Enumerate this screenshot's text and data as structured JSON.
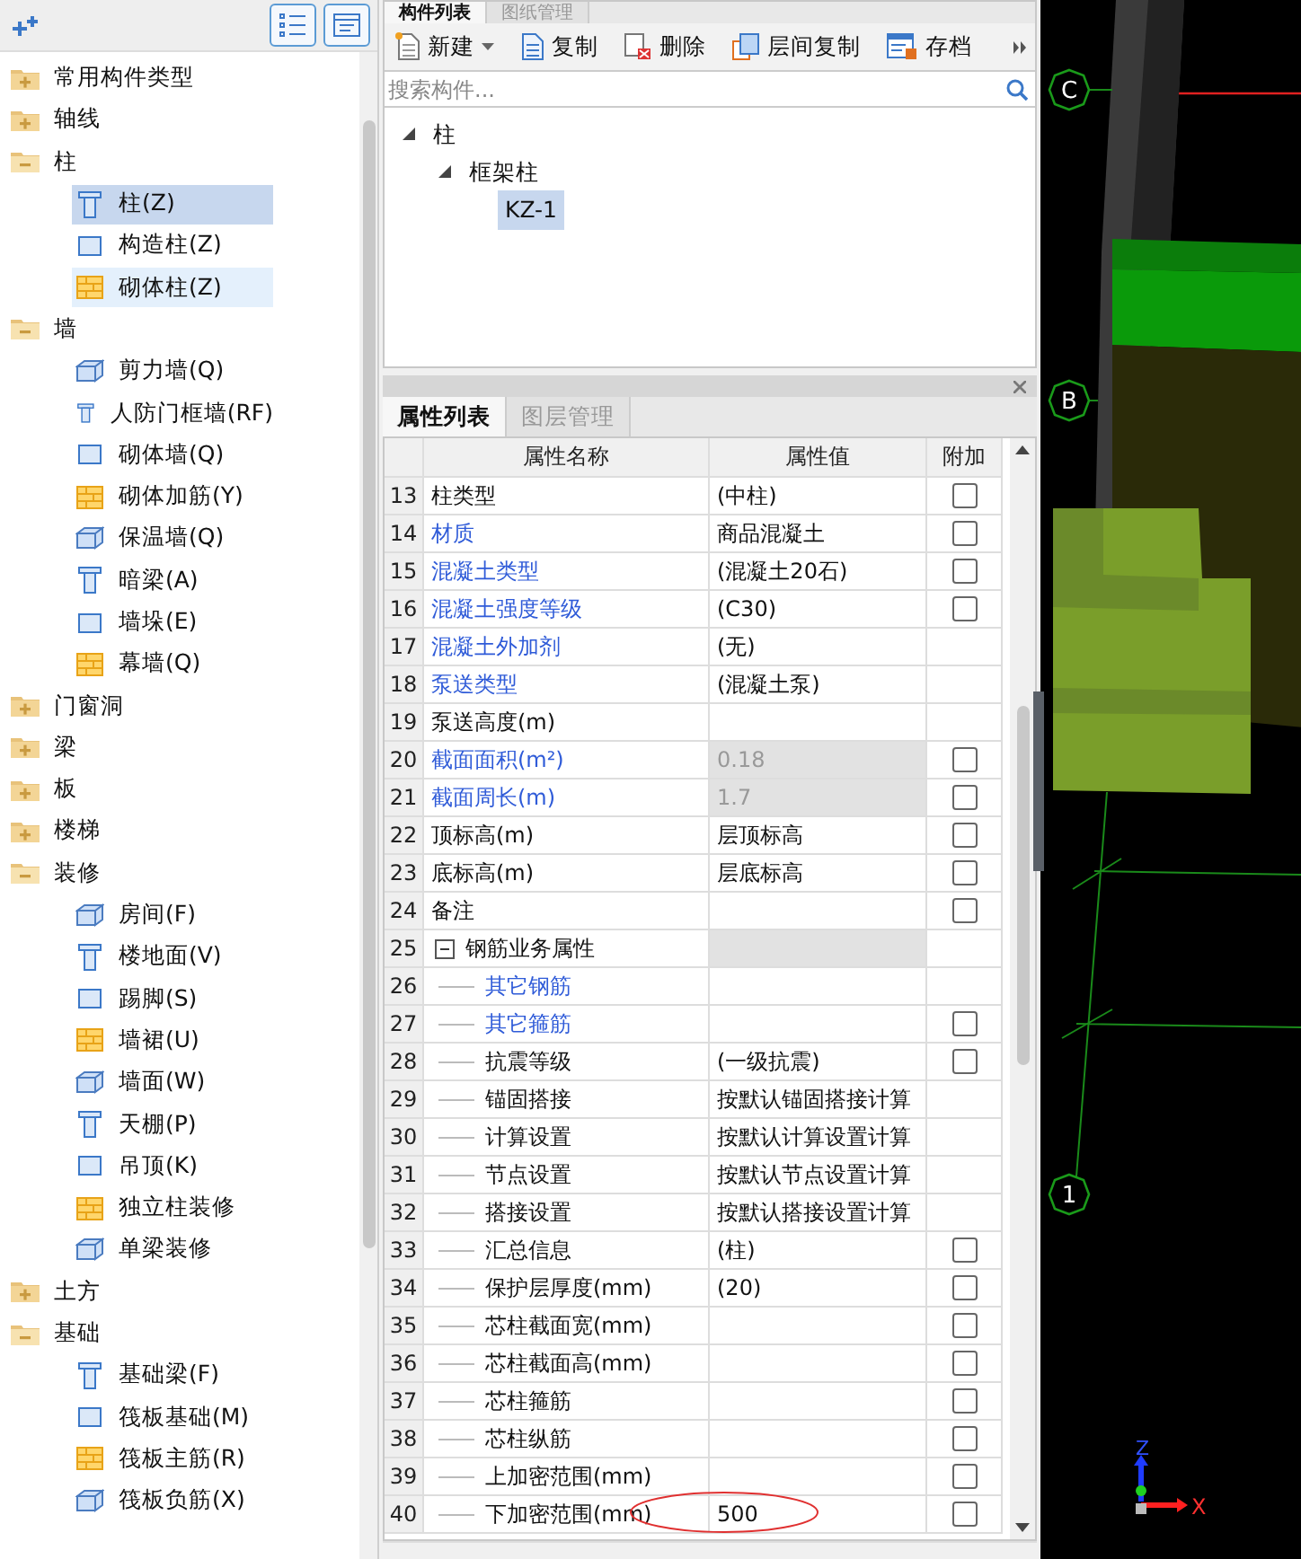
{
  "left_panel": {
    "categories": [
      {
        "label": "常用构件类型",
        "expanded": false
      },
      {
        "label": "轴线",
        "expanded": false
      },
      {
        "label": "柱",
        "expanded": true,
        "children": [
          {
            "label": "柱(Z)",
            "selected": true,
            "hovered": false
          },
          {
            "label": "构造柱(Z)",
            "selected": false,
            "hovered": false
          },
          {
            "label": "砌体柱(Z)",
            "selected": false,
            "hovered": true
          }
        ]
      },
      {
        "label": "墙",
        "expanded": true,
        "children": [
          {
            "label": "剪力墙(Q)",
            "selected": false,
            "hovered": false
          },
          {
            "label": "人防门框墙(RF)",
            "selected": false,
            "hovered": false
          },
          {
            "label": "砌体墙(Q)",
            "selected": false,
            "hovered": false
          },
          {
            "label": "砌体加筋(Y)",
            "selected": false,
            "hovered": false
          },
          {
            "label": "保温墙(Q)",
            "selected": false,
            "hovered": false
          },
          {
            "label": "暗梁(A)",
            "selected": false,
            "hovered": false
          },
          {
            "label": "墙垛(E)",
            "selected": false,
            "hovered": false
          },
          {
            "label": "幕墙(Q)",
            "selected": false,
            "hovered": false
          }
        ]
      },
      {
        "label": "门窗洞",
        "expanded": false
      },
      {
        "label": "梁",
        "expanded": false
      },
      {
        "label": "板",
        "expanded": false
      },
      {
        "label": "楼梯",
        "expanded": false
      },
      {
        "label": "装修",
        "expanded": true,
        "children": [
          {
            "label": "房间(F)",
            "selected": false,
            "hovered": false
          },
          {
            "label": "楼地面(V)",
            "selected": false,
            "hovered": false
          },
          {
            "label": "踢脚(S)",
            "selected": false,
            "hovered": false
          },
          {
            "label": "墙裙(U)",
            "selected": false,
            "hovered": false
          },
          {
            "label": "墙面(W)",
            "selected": false,
            "hovered": false
          },
          {
            "label": "天棚(P)",
            "selected": false,
            "hovered": false
          },
          {
            "label": "吊顶(K)",
            "selected": false,
            "hovered": false
          },
          {
            "label": "独立柱装修",
            "selected": false,
            "hovered": false
          },
          {
            "label": "单梁装修",
            "selected": false,
            "hovered": false
          }
        ]
      },
      {
        "label": "土方",
        "expanded": false
      },
      {
        "label": "基础",
        "expanded": true,
        "children": [
          {
            "label": "基础梁(F)",
            "selected": false,
            "hovered": false
          },
          {
            "label": "筏板基础(M)",
            "selected": false,
            "hovered": false
          },
          {
            "label": "筏板主筋(R)",
            "selected": false,
            "hovered": false
          },
          {
            "label": "筏板负筋(X)",
            "selected": false,
            "hovered": false
          }
        ]
      }
    ]
  },
  "component_panel": {
    "tabs": [
      {
        "label": "构件列表",
        "selected": true
      },
      {
        "label": "图纸管理",
        "selected": false
      }
    ],
    "toolbar": [
      {
        "kind": "new",
        "label": "新建"
      },
      {
        "kind": "copy",
        "label": "复制"
      },
      {
        "kind": "delete",
        "label": "删除"
      },
      {
        "kind": "floor-copy",
        "label": "层间复制"
      },
      {
        "kind": "save",
        "label": "存档"
      }
    ],
    "search": {
      "placeholder": "搜索构件..."
    },
    "tree": [
      {
        "label": "柱",
        "expanded": true,
        "selected": false,
        "children": [
          {
            "label": "框架柱",
            "expanded": true,
            "selected": false,
            "children": [
              {
                "label": "KZ-1",
                "selected": true
              }
            ]
          }
        ]
      }
    ]
  },
  "property_panel": {
    "tabs": [
      {
        "label": "属性列表",
        "selected": true
      },
      {
        "label": "图层管理",
        "selected": false
      }
    ],
    "columns": [
      "属性名称",
      "属性值",
      "附加"
    ],
    "rows": [
      {
        "no": "13",
        "name": "柱类型",
        "value": "(中柱)",
        "linked": false,
        "readonly": false,
        "checked": false
      },
      {
        "no": "14",
        "name": "材质",
        "value": "商品混凝土",
        "linked": true,
        "readonly": false,
        "checked": false
      },
      {
        "no": "15",
        "name": "混凝土类型",
        "value": "(混凝土20石)",
        "linked": true,
        "readonly": false,
        "checked": false
      },
      {
        "no": "16",
        "name": "混凝土强度等级",
        "value": "(C30)",
        "linked": true,
        "readonly": false,
        "checked": false
      },
      {
        "no": "17",
        "name": "混凝土外加剂",
        "value": "(无)",
        "linked": true,
        "readonly": false
      },
      {
        "no": "18",
        "name": "泵送类型",
        "value": "(混凝土泵)",
        "linked": true,
        "readonly": false
      },
      {
        "no": "19",
        "name": "泵送高度(m)",
        "linked": false,
        "readonly": false
      },
      {
        "no": "20",
        "name": "截面面积(m²)",
        "value": "0.18",
        "linked": true,
        "readonly": true,
        "checked": false
      },
      {
        "no": "21",
        "name": "截面周长(m)",
        "value": "1.7",
        "linked": true,
        "readonly": true,
        "checked": false
      },
      {
        "no": "22",
        "name": "顶标高(m)",
        "value": "层顶标高",
        "linked": false,
        "readonly": false,
        "checked": false
      },
      {
        "no": "23",
        "name": "底标高(m)",
        "value": "层底标高",
        "linked": false,
        "readonly": false,
        "checked": false
      },
      {
        "no": "24",
        "name": "备注",
        "linked": false,
        "readonly": false,
        "checked": false
      },
      {
        "no": "25",
        "name": "钢筋业务属性",
        "linked": false,
        "readonly": true,
        "expanded": true,
        "children": [
          {
            "no": "26",
            "name": "其它钢筋",
            "linked": true,
            "readonly": false
          },
          {
            "no": "27",
            "name": "其它箍筋",
            "linked": true,
            "readonly": false,
            "checked": false
          },
          {
            "no": "28",
            "name": "抗震等级",
            "value": "(一级抗震)",
            "linked": false,
            "readonly": false,
            "checked": false
          },
          {
            "no": "29",
            "name": "锚固搭接",
            "value": "按默认锚固搭接计算",
            "linked": false,
            "readonly": false
          },
          {
            "no": "30",
            "name": "计算设置",
            "value": "按默认计算设置计算",
            "linked": false,
            "readonly": false
          },
          {
            "no": "31",
            "name": "节点设置",
            "value": "按默认节点设置计算",
            "linked": false,
            "readonly": false
          },
          {
            "no": "32",
            "name": "搭接设置",
            "value": "按默认搭接设置计算",
            "linked": false,
            "readonly": false
          },
          {
            "no": "33",
            "name": "汇总信息",
            "value": "(柱)",
            "linked": false,
            "readonly": false,
            "checked": false
          },
          {
            "no": "34",
            "name": "保护层厚度(mm)",
            "value": "(20)",
            "linked": false,
            "readonly": false,
            "checked": false
          },
          {
            "no": "35",
            "name": "芯柱截面宽(mm)",
            "linked": false,
            "readonly": false,
            "checked": false
          },
          {
            "no": "36",
            "name": "芯柱截面高(mm)",
            "linked": false,
            "readonly": false,
            "checked": false
          },
          {
            "no": "37",
            "name": "芯柱箍筋",
            "linked": false,
            "readonly": false,
            "checked": false
          },
          {
            "no": "38",
            "name": "芯柱纵筋",
            "linked": false,
            "readonly": false,
            "checked": false
          },
          {
            "no": "39",
            "name": "上加密范围(mm)",
            "linked": false,
            "readonly": false,
            "checked": false
          },
          {
            "no": "40",
            "name": "下加密范围(mm)",
            "value": "500",
            "linked": false,
            "readonly": false,
            "checked": false,
            "circled": true
          }
        ]
      }
    ]
  },
  "viewport": {
    "axis_bubbles": [
      {
        "label": "C"
      },
      {
        "label": "B"
      },
      {
        "label": "1"
      }
    ],
    "gizmo": {
      "z_label": "Z",
      "x_label": "X"
    }
  }
}
